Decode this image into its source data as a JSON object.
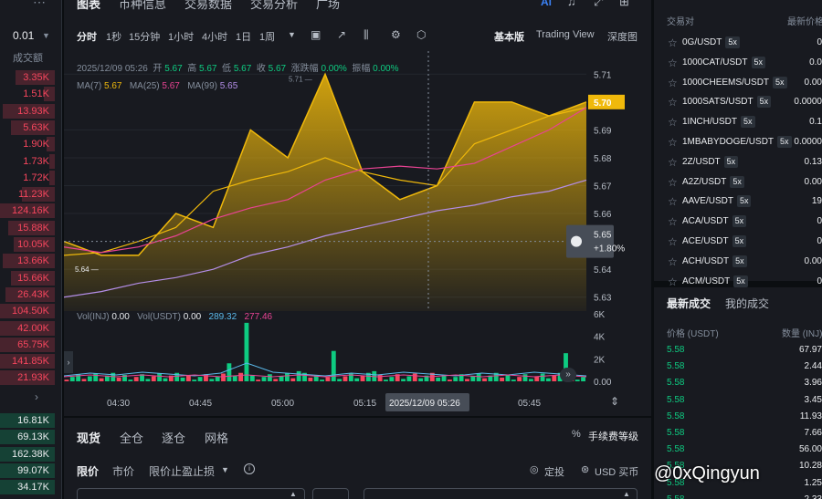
{
  "colors": {
    "up": "#0ecb81",
    "down": "#f6465d",
    "accent": "#f0b90b",
    "ma7": "#f0b90b",
    "ma25": "#e84393",
    "ma99": "#b48ee8"
  },
  "left": {
    "step_value": "0.01",
    "volume_header": "成交额",
    "rows_top": [
      {
        "value": "3.35K",
        "fill": 0.72
      },
      {
        "value": "1.51K",
        "fill": 0.2
      },
      {
        "value": "13.93K",
        "fill": 0.95
      },
      {
        "value": "5.63K",
        "fill": 0.8
      },
      {
        "value": "1.90K",
        "fill": 0.15
      },
      {
        "value": "1.73K",
        "fill": 0.1
      },
      {
        "value": "1.72K",
        "fill": 0.1
      },
      {
        "value": "11.23K",
        "fill": 0.6
      },
      {
        "value": "124.16K",
        "fill": 1.0
      },
      {
        "value": "15.88K",
        "fill": 0.85
      },
      {
        "value": "10.05K",
        "fill": 0.75
      },
      {
        "value": "13.66K",
        "fill": 0.95
      },
      {
        "value": "15.66K",
        "fill": 0.8
      },
      {
        "value": "26.43K",
        "fill": 0.9
      },
      {
        "value": "104.50K",
        "fill": 1.0
      },
      {
        "value": "42.00K",
        "fill": 1.0
      },
      {
        "value": "65.75K",
        "fill": 1.0
      },
      {
        "value": "141.85K",
        "fill": 1.0
      },
      {
        "value": "21.93K",
        "fill": 1.0
      }
    ],
    "rows_bottom": [
      {
        "value": "16.81K",
        "fill": 1.0
      },
      {
        "value": "69.13K",
        "fill": 1.0
      },
      {
        "value": "162.38K",
        "fill": 1.0
      },
      {
        "value": "99.07K",
        "fill": 1.0
      },
      {
        "value": "34.17K",
        "fill": 1.0
      }
    ]
  },
  "chart": {
    "tabs": [
      "图表",
      "币种信息",
      "交易数据",
      "交易分析",
      "广场"
    ],
    "timeframes": [
      "分时",
      "1秒",
      "15分钟",
      "1小时",
      "4小时",
      "1日",
      "1周"
    ],
    "views": [
      "基本版",
      "Trading View",
      "深度图"
    ],
    "ohlc": {
      "date": "2025/12/09 05:26",
      "open_label": "开",
      "open": "5.67",
      "high_label": "高",
      "high": "5.67",
      "low_label": "低",
      "low": "5.67",
      "close_label": "收",
      "close": "5.67",
      "chg_label": "涨跌幅",
      "chg": "0.00%",
      "amp_label": "振幅",
      "amp": "0.00%"
    },
    "ma": {
      "ma7_label": "MA(7)",
      "ma7": "5.67",
      "ma25_label": "MA(25)",
      "ma25": "5.67",
      "ma99_label": "MA(99)",
      "ma99": "5.65"
    },
    "vol": {
      "inj_label": "Vol(INJ)",
      "inj": "0.00",
      "usdt_label": "Vol(USDT)",
      "usdt": "0.00",
      "v1": "289.32",
      "v2": "277.46"
    },
    "price_ticks": [
      "5.71",
      "5.69",
      "5.68",
      "5.67",
      "5.66",
      "5.64",
      "5.63"
    ],
    "current_price": "5.70",
    "cross_price": "5.65",
    "cross_change": "+1.80%",
    "high_marker": "5.71",
    "low_marker": "5.64",
    "vol_ticks": [
      "6K",
      "4K",
      "2K",
      "0.00"
    ],
    "time_ticks": [
      "04:30",
      "04:45",
      "05:00",
      "05:15",
      "05:45"
    ],
    "cross_time": "2025/12/09 05:26"
  },
  "chart_data": {
    "type": "area",
    "title": "",
    "x": [
      "04:24",
      "04:30",
      "04:36",
      "04:42",
      "04:48",
      "04:54",
      "05:00",
      "05:06",
      "05:12",
      "05:18",
      "05:24",
      "05:30",
      "05:36",
      "05:42",
      "05:48"
    ],
    "series": [
      {
        "name": "MA(7)",
        "values": [
          5.645,
          5.646,
          5.65,
          5.655,
          5.668,
          5.672,
          5.675,
          5.68,
          5.675,
          5.672,
          5.67,
          5.685,
          5.69,
          5.695,
          5.698
        ]
      },
      {
        "name": "MA(25)",
        "values": [
          5.648,
          5.646,
          5.648,
          5.652,
          5.658,
          5.662,
          5.665,
          5.672,
          5.676,
          5.677,
          5.676,
          5.678,
          5.684,
          5.69,
          5.698
        ]
      },
      {
        "name": "MA(99)",
        "values": [
          5.63,
          5.632,
          5.635,
          5.637,
          5.64,
          5.645,
          5.648,
          5.652,
          5.655,
          5.658,
          5.661,
          5.663,
          5.666,
          5.668,
          5.672
        ]
      }
    ],
    "price": [
      5.65,
      5.645,
      5.645,
      5.66,
      5.655,
      5.69,
      5.68,
      5.71,
      5.675,
      5.665,
      5.67,
      5.7,
      5.7,
      5.695,
      5.7
    ],
    "ylim": [
      5.625,
      5.715
    ],
    "volume_ylim": [
      0,
      6000
    ]
  },
  "pairs": {
    "col_pair": "交易对",
    "col_price": "最新价格",
    "rows": [
      {
        "sym": "0G/USDT",
        "lev": "5x",
        "px": "0"
      },
      {
        "sym": "1000CAT/USDT",
        "lev": "5x",
        "px": "0.0"
      },
      {
        "sym": "1000CHEEMS/USDT",
        "lev": "5x",
        "px": "0.00"
      },
      {
        "sym": "1000SATS/USDT",
        "lev": "5x",
        "px": "0.0000"
      },
      {
        "sym": "1INCH/USDT",
        "lev": "5x",
        "px": "0.1"
      },
      {
        "sym": "1MBABYDOGE/USDT",
        "lev": "5x",
        "px": "0.0000"
      },
      {
        "sym": "2Z/USDT",
        "lev": "5x",
        "px": "0.13"
      },
      {
        "sym": "A2Z/USDT",
        "lev": "5x",
        "px": "0.00"
      },
      {
        "sym": "AAVE/USDT",
        "lev": "5x",
        "px": "19"
      },
      {
        "sym": "ACA/USDT",
        "lev": "5x",
        "px": "0"
      },
      {
        "sym": "ACE/USDT",
        "lev": "5x",
        "px": "0"
      },
      {
        "sym": "ACH/USDT",
        "lev": "5x",
        "px": "0.00"
      },
      {
        "sym": "ACM/USDT",
        "lev": "5x",
        "px": "0"
      }
    ]
  },
  "trades": {
    "tab_latest": "最新成交",
    "tab_mine": "我的成交",
    "col_price": "价格 (USDT)",
    "col_qty": "数量 (INJ)",
    "rows": [
      {
        "price": "5.58",
        "qty": "67.97"
      },
      {
        "price": "5.58",
        "qty": "2.44"
      },
      {
        "price": "5.58",
        "qty": "3.96"
      },
      {
        "price": "5.58",
        "qty": "3.45"
      },
      {
        "price": "5.58",
        "qty": "11.93"
      },
      {
        "price": "5.58",
        "qty": "7.66"
      },
      {
        "price": "5.58",
        "qty": "56.00"
      },
      {
        "price": "5.58",
        "qty": "10.28"
      },
      {
        "price": "5.58",
        "qty": "1.25"
      },
      {
        "price": "5.58",
        "qty": "2.33"
      }
    ]
  },
  "order": {
    "tabs": [
      "现货",
      "全仓",
      "逐仓",
      "网格"
    ],
    "fee_label": "手续费等级",
    "types": [
      "限价",
      "市价",
      "限价止盈止损"
    ],
    "tp_sl": "定投",
    "usd_buy": "USD 买币"
  },
  "watermark": "@0xQingyun"
}
